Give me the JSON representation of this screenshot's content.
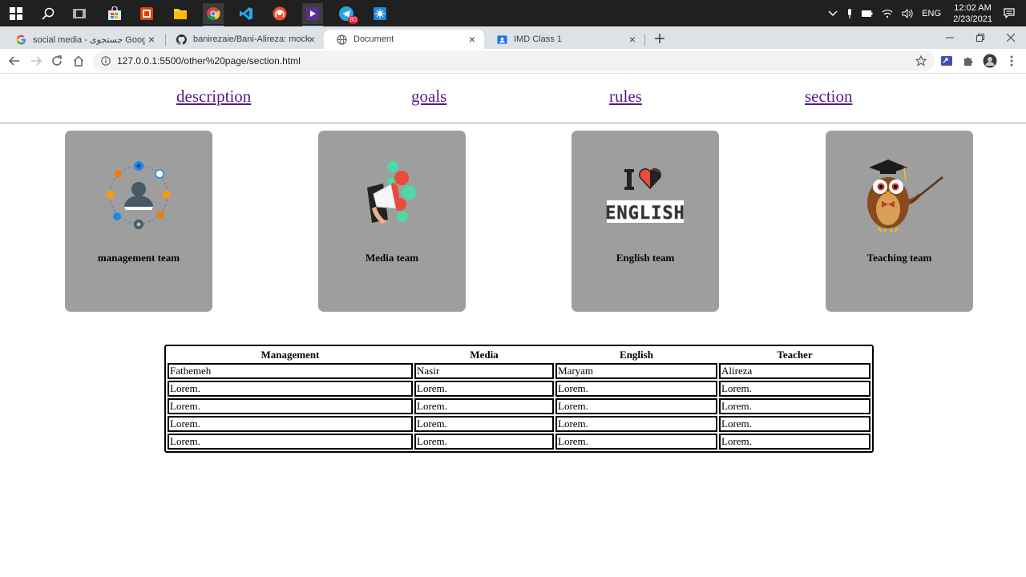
{
  "taskbar": {
    "icons": [
      "windows-start-icon",
      "search-icon",
      "task-view-icon",
      "store-icon",
      "office-icon",
      "file-explorer-icon",
      "chrome-icon",
      "vscode-icon",
      "podcast-icon",
      "visual-studio-icon",
      "telegram-icon",
      "app-icon"
    ],
    "telegram_badge": "80",
    "language": "ENG",
    "time": "12:02 AM",
    "date": "2/23/2021"
  },
  "tabs": [
    {
      "title": "social media - جستجوی Google",
      "icon": "google-icon",
      "active": false
    },
    {
      "title": "banirezaie/Bani-Alireza: mock-ht",
      "icon": "github-icon",
      "active": false
    },
    {
      "title": "Document",
      "icon": "globe-icon",
      "active": true
    },
    {
      "title": "IMD Class 1",
      "icon": "classroom-icon",
      "active": false
    }
  ],
  "toolbar": {
    "url": "127.0.0.1:5500/other%20page/section.html"
  },
  "nav": {
    "links": [
      "description",
      "goals",
      "rules",
      "section"
    ]
  },
  "cards": [
    {
      "label": "management team",
      "icon": "management-network-icon"
    },
    {
      "label": "Media team",
      "icon": "megaphone-icon"
    },
    {
      "label": "English team",
      "icon": "i-love-english-icon"
    },
    {
      "label": "Teaching team",
      "icon": "owl-teacher-icon"
    }
  ],
  "table": {
    "headers": [
      "Management",
      "Media",
      "English",
      "Teacher"
    ],
    "rows": [
      [
        "Fathemeh",
        "Nasir",
        "Maryam",
        "Alireza"
      ],
      [
        "Lorem.",
        "Lorem.",
        "Lorem.",
        "Lorem."
      ],
      [
        "Lorem.",
        "Lorem.",
        "Lorem.",
        "Lorem."
      ],
      [
        "Lorem.",
        "Lorem.",
        "Lorem.",
        "Lorem."
      ],
      [
        "Lorem.",
        "Lorem.",
        "Lorem.",
        "Lorem."
      ]
    ]
  },
  "colors": {
    "taskbar": "#202020",
    "tabstrip": "#dee1e6",
    "card": "#9e9e9e",
    "link": "#551a8b"
  }
}
